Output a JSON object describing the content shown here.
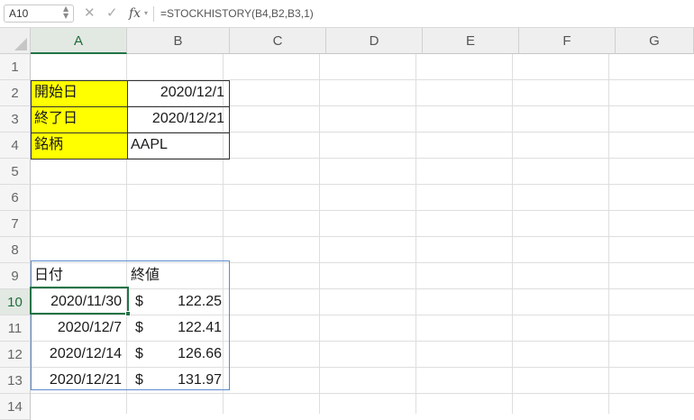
{
  "formula_bar": {
    "name_box": "A10",
    "cancel_icon": "✕",
    "confirm_icon": "✓",
    "fx_label": "fx",
    "formula": "=STOCKHISTORY(B4,B2,B3,1)"
  },
  "columns": [
    "A",
    "B",
    "C",
    "D",
    "E",
    "F",
    "G"
  ],
  "rows": [
    "1",
    "2",
    "3",
    "4",
    "5",
    "6",
    "7",
    "8",
    "9",
    "10",
    "11",
    "12",
    "13",
    "14"
  ],
  "cells": {
    "A2": "開始日",
    "B2": "2020/12/1",
    "A3": "終了日",
    "B3": "2020/12/21",
    "A4": "銘柄",
    "B4": "AAPL",
    "A9": "日付",
    "B9": "終値",
    "A10": "2020/11/30",
    "B10_currency": "$",
    "B10_amount": "122.25",
    "A11": "2020/12/7",
    "B11_currency": "$",
    "B11_amount": "122.41",
    "A12": "2020/12/14",
    "B12_currency": "$",
    "B12_amount": "126.66",
    "A13": "2020/12/21",
    "B13_currency": "$",
    "B13_amount": "131.97"
  },
  "selection": {
    "active_cell": "A10"
  },
  "colors": {
    "input_fill": "#ffff00",
    "selection_green": "#217346",
    "spill_border": "#5b8bd0"
  }
}
